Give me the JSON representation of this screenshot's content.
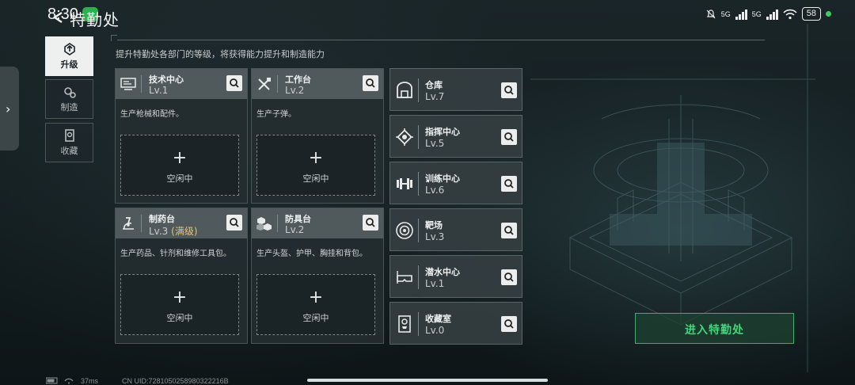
{
  "statusbar": {
    "time": "8:30",
    "net_a": "5G",
    "net_b": "5G",
    "battery": "58"
  },
  "header": {
    "title": "特勤处",
    "subtitle": "提升特勤处各部门的等级，将获得能力提升和制造能力"
  },
  "sidebar": {
    "tabs": [
      {
        "label": "升级",
        "icon": "upgrade-icon",
        "active": true
      },
      {
        "label": "制造",
        "icon": "gears-icon",
        "active": false
      },
      {
        "label": "收藏",
        "icon": "collection-icon",
        "active": false
      }
    ]
  },
  "cards": [
    {
      "name": "技术中心",
      "level": "Lv.1",
      "max_tag": "",
      "desc": "生产枪械和配件。",
      "slot_label": "空闲中",
      "icon": "tech-center-icon"
    },
    {
      "name": "工作台",
      "level": "Lv.2",
      "max_tag": "",
      "desc": "生产子弹。",
      "slot_label": "空闲中",
      "icon": "tools-icon"
    },
    {
      "name": "制药台",
      "level": "Lv.3",
      "max_tag": "(满级)",
      "desc": "生产药品、针剂和维修工具包。",
      "slot_label": "空闲中",
      "icon": "microscope-icon"
    },
    {
      "name": "防具台",
      "level": "Lv.2",
      "max_tag": "",
      "desc": "生产头盔、护甲、胸挂和背包。",
      "slot_label": "空闲中",
      "icon": "armor-cubes-icon"
    }
  ],
  "facilities": [
    {
      "name": "仓库",
      "level": "Lv.7",
      "icon": "warehouse-icon"
    },
    {
      "name": "指挥中心",
      "level": "Lv.5",
      "icon": "chip-icon"
    },
    {
      "name": "训练中心",
      "level": "Lv.6",
      "icon": "dumbbell-icon"
    },
    {
      "name": "靶场",
      "level": "Lv.3",
      "icon": "target-icon"
    },
    {
      "name": "潜水中心",
      "level": "Lv.1",
      "icon": "diving-mask-icon"
    },
    {
      "name": "收藏室",
      "level": "Lv.0",
      "icon": "trophy-case-icon"
    }
  ],
  "enter_button": "进入特勤处",
  "footer": {
    "ping": "37ms",
    "uid": "CN UID:7281050258980322216B"
  },
  "colors": {
    "accent_green": "#45d37c",
    "max_level_gold": "#e4c46a",
    "card_header": "#505a5d"
  }
}
